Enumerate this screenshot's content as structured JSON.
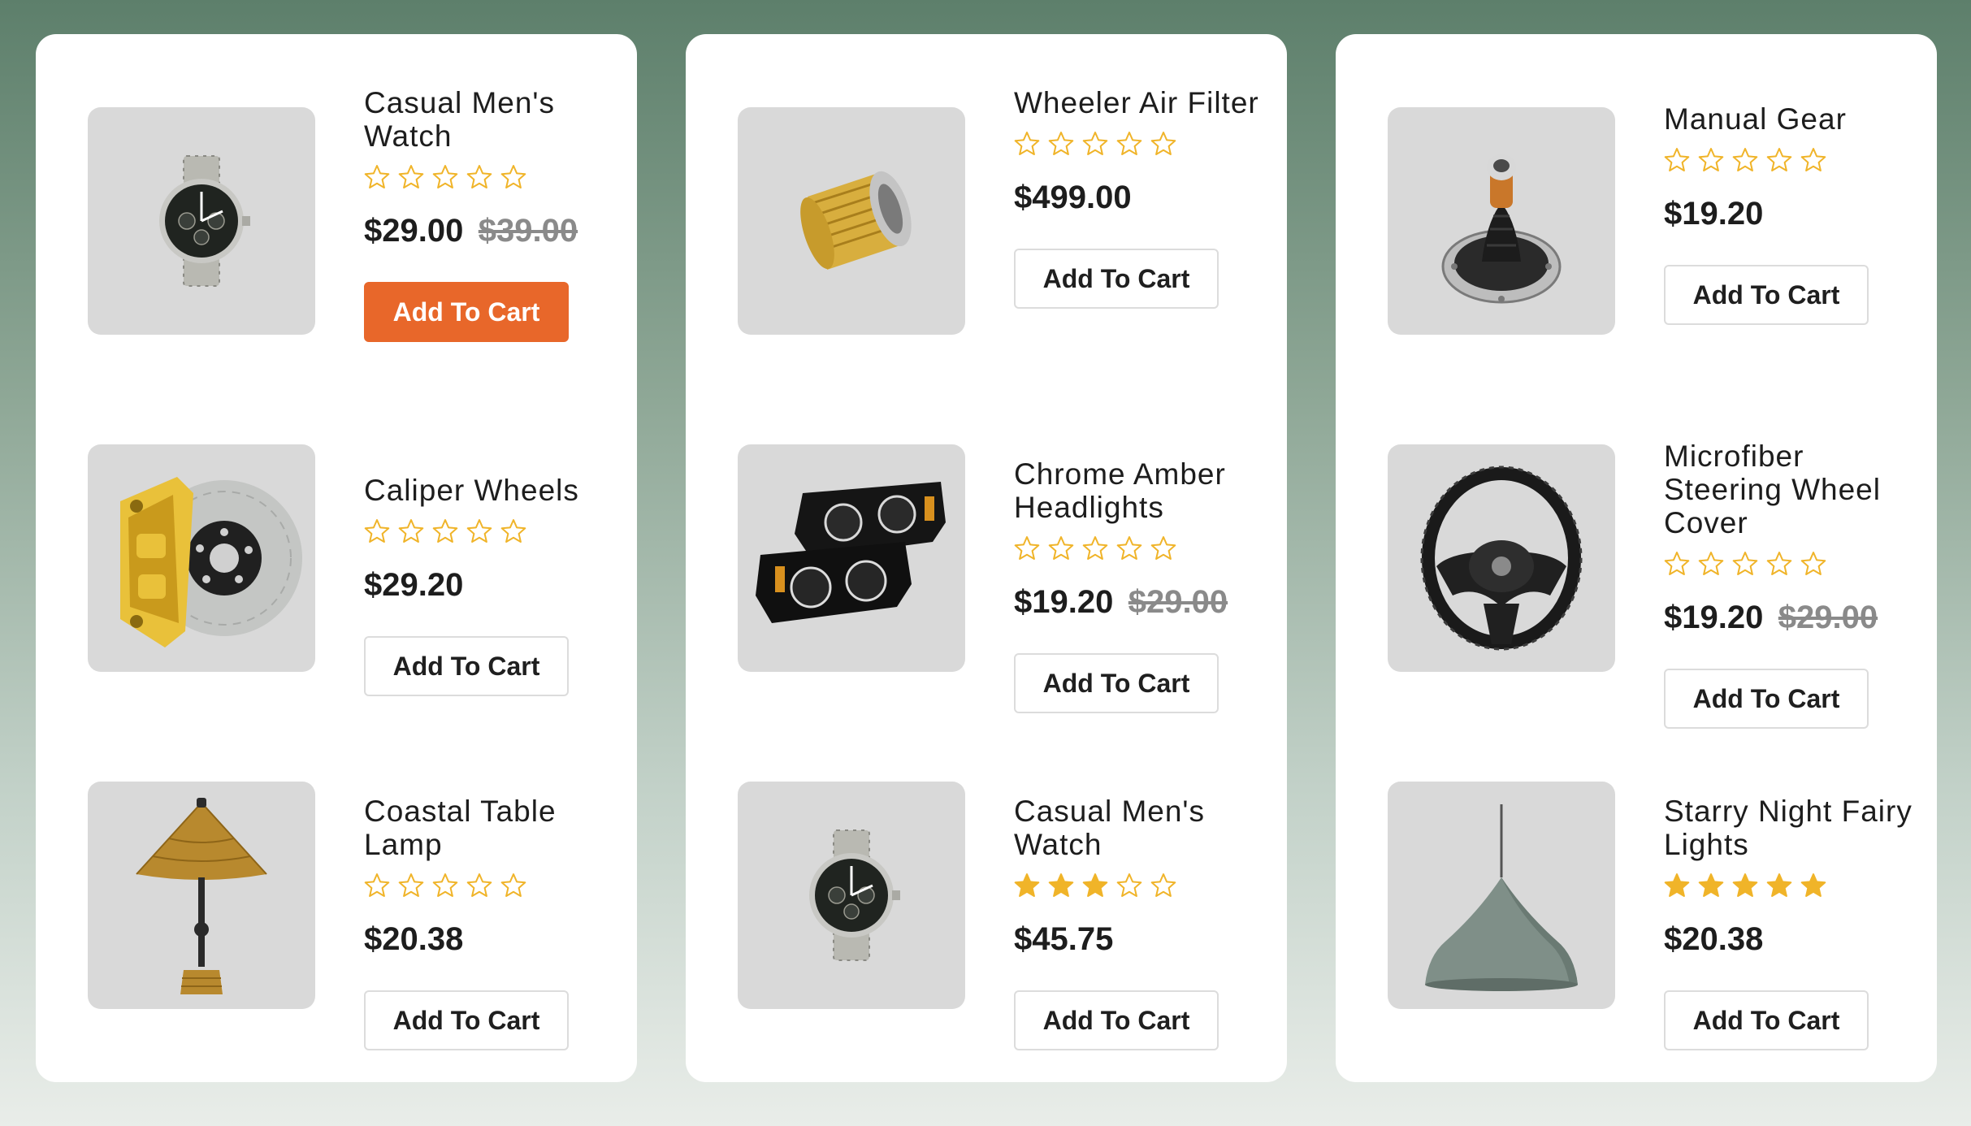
{
  "colors": {
    "accent": "#e8672a",
    "star": "#f0b429",
    "card_background": "#ffffff",
    "thumbnail_background": "#d9d9d9"
  },
  "columns": [
    {
      "products": [
        {
          "title": "Casual Men's Watch",
          "rating": 0,
          "price": "$29.00",
          "old_price": "$39.00",
          "cart_label": "Add To Cart",
          "cart_active": true,
          "image_icon": "watch-icon"
        },
        {
          "title": "Caliper Wheels",
          "rating": 0,
          "price": "$29.20",
          "old_price": "",
          "cart_label": "Add To Cart",
          "cart_active": false,
          "image_icon": "brake-caliper-icon"
        },
        {
          "title": "Coastal Table Lamp",
          "rating": 0,
          "price": "$20.38",
          "old_price": "",
          "cart_label": "Add To Cart",
          "cart_active": false,
          "image_icon": "table-lamp-icon"
        }
      ]
    },
    {
      "products": [
        {
          "title": "Wheeler Air Filter",
          "rating": 0,
          "price": "$499.00",
          "old_price": "",
          "cart_label": "Add To Cart",
          "cart_active": false,
          "image_icon": "air-filter-icon"
        },
        {
          "title": "Chrome Amber Headlights",
          "rating": 0,
          "price": "$19.20",
          "old_price": "$29.00",
          "cart_label": "Add To Cart",
          "cart_active": false,
          "image_icon": "headlights-icon"
        },
        {
          "title": "Casual Men's Watch",
          "rating": 3,
          "price": "$45.75",
          "old_price": "",
          "cart_label": "Add To Cart",
          "cart_active": false,
          "image_icon": "watch-icon"
        }
      ]
    },
    {
      "products": [
        {
          "title": "Manual Gear",
          "rating": 0,
          "price": "$19.20",
          "old_price": "",
          "cart_label": "Add To Cart",
          "cart_active": false,
          "image_icon": "gear-shifter-icon"
        },
        {
          "title": "Microfiber Steering Wheel Cover",
          "rating": 0,
          "price": "$19.20",
          "old_price": "$29.00",
          "cart_label": "Add To Cart",
          "cart_active": false,
          "image_icon": "steering-wheel-icon"
        },
        {
          "title": "Starry Night Fairy Lights",
          "rating": 5,
          "price": "$20.38",
          "old_price": "",
          "cart_label": "Add To Cart",
          "cart_active": false,
          "image_icon": "pendant-lamp-icon"
        }
      ]
    }
  ]
}
